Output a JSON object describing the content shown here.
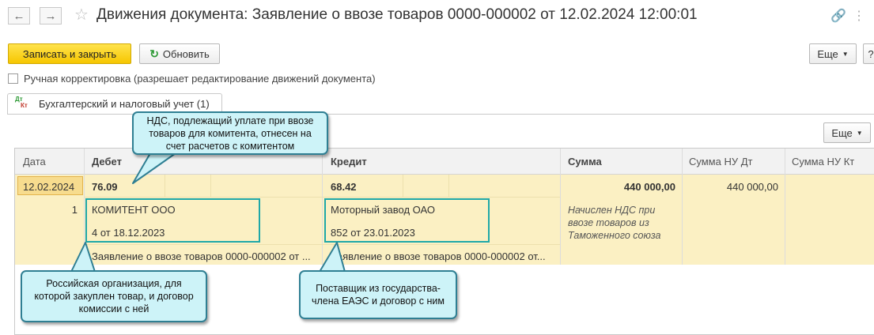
{
  "window": {
    "title": "Движения документа: Заявление о ввозе товаров 0000-000002 от 12.02.2024 12:00:01",
    "back_icon": "arrow-left-icon",
    "forward_icon": "arrow-right-icon"
  },
  "toolbar": {
    "save_close_label": "Записать и закрыть",
    "refresh_label": "Обновить",
    "more_label": "Еще"
  },
  "manual_edit": {
    "label": "Ручная корректировка (разрешает редактирование движений документа)",
    "checked": false
  },
  "tab": {
    "icon_top": "Дт",
    "icon_bottom": "Кт",
    "label": "Бухгалтерский и налоговый учет (1)"
  },
  "table": {
    "more_label": "Еще",
    "columns": [
      "Дата",
      "Дебет",
      "Кредит",
      "Сумма",
      "Сумма НУ Дт",
      "Сумма НУ Кт"
    ],
    "row": {
      "date": "12.02.2024",
      "number": "1",
      "debit_account": "76.09",
      "debit_sub1": "КОМИТЕНТ ООО",
      "debit_sub2": "4 от 18.12.2023",
      "debit_sub3": "Заявление о ввозе товаров 0000-000002 от ...",
      "credit_account": "68.42",
      "credit_sub1": "Моторный завод ОАО",
      "credit_sub2": "852 от 23.01.2023",
      "credit_sub3": "Заявление о ввозе товаров 0000-000002 от...",
      "amount": "440 000,00",
      "content": "Начислен НДС при ввозе товаров из Таможенного союза",
      "amount_nu_dt": "440 000,00",
      "amount_nu_kt": ""
    }
  },
  "callouts": {
    "vat": "НДС, подлежащий уплате при ввозе товаров для комитента, отнесен на счет расчетов с комитентом",
    "org": "Российская организация, для которой закуплен товар, и договор комиссии с ней",
    "supplier": "Поставщик из государства-члена ЕАЭС и договор с ним"
  },
  "colors": {
    "primary_button": "#f6c600",
    "row_highlight": "#fbf0c3",
    "callout_fill": "#cdf3f8",
    "callout_border": "#2f7f93",
    "highlight_border": "#1fa8a8"
  }
}
